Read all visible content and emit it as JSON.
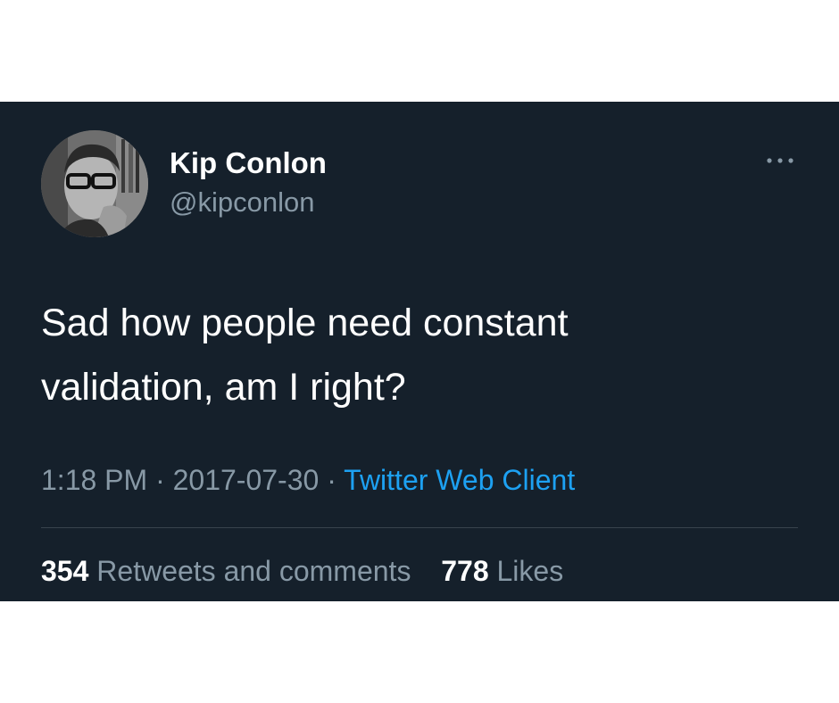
{
  "tweet": {
    "display_name": "Kip Conlon",
    "handle": "@kipconlon",
    "text_line1": "Sad how people need constant",
    "text_line2": "validation, am I right?",
    "time": "1:18 PM",
    "date": "2017-07-30",
    "separator": "·",
    "source": "Twitter Web Client",
    "retweets_count": "354",
    "retweets_label": "Retweets and comments",
    "likes_count": "778",
    "likes_label": "Likes",
    "more_icon": "more-horizontal-icon"
  },
  "colors": {
    "background": "#15202b",
    "primary_text": "#ffffff",
    "secondary_text": "#8899a6",
    "link": "#1da1f2",
    "divider": "#38444d"
  }
}
